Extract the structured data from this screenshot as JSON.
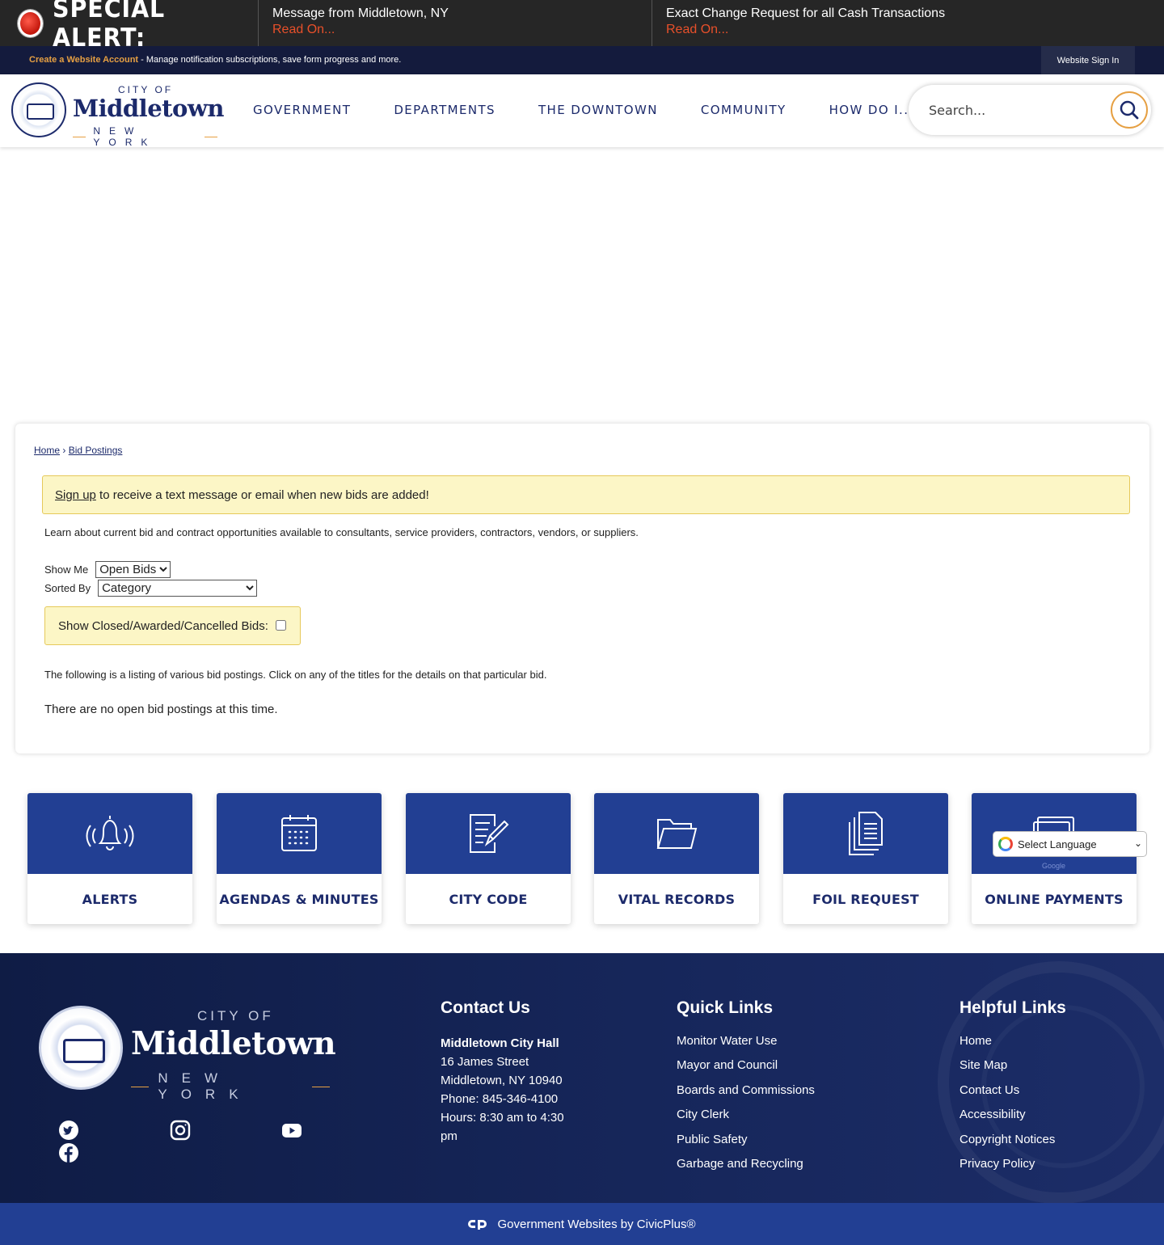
{
  "alert": {
    "title": "SPECIAL ALERT:",
    "messages": [
      {
        "title": "Message from Middletown, NY",
        "read_more": "Read On..."
      },
      {
        "title": "Exact Change Request for all Cash Transactions",
        "read_more": "Read On..."
      }
    ]
  },
  "account_bar": {
    "create_link": "Create a Website Account",
    "description": " - Manage notification subscriptions, save form progress and more.",
    "sign_in": "Website Sign In"
  },
  "header": {
    "logo": {
      "city_of": "CITY OF",
      "name": "Middletown",
      "state": "NEW YORK"
    },
    "nav": [
      "GOVERNMENT",
      "DEPARTMENTS",
      "THE DOWNTOWN",
      "COMMUNITY",
      "HOW DO I..."
    ],
    "search_placeholder": "Search..."
  },
  "main": {
    "breadcrumb": {
      "home": "Home",
      "separator": "›",
      "current": "Bid Postings"
    },
    "signup_link": "Sign up",
    "signup_text": " to receive a text message or email when new bids are added!",
    "intro": "Learn about current bid and contract opportunities available to consultants, service providers, contractors, vendors, or suppliers.",
    "show_me": {
      "label": "Show Me",
      "selected": "Open Bids"
    },
    "sorted_by": {
      "label": "Sorted By",
      "selected": "Category"
    },
    "show_closed_label": "Show Closed/Awarded/Cancelled Bids:",
    "show_closed_checked": false,
    "listing_note": "The following is a listing of various bid postings. Click on any of the titles for the details on that particular bid.",
    "empty_message": "There are no open bid postings at this time."
  },
  "quick_links": [
    {
      "label": "ALERTS",
      "icon": "bell-icon"
    },
    {
      "label": "AGENDAS & MINUTES",
      "icon": "calendar-icon"
    },
    {
      "label": "CITY CODE",
      "icon": "document-edit-icon"
    },
    {
      "label": "VITAL RECORDS",
      "icon": "folder-icon"
    },
    {
      "label": "FOIL REQUEST",
      "icon": "documents-icon"
    },
    {
      "label": "ONLINE PAYMENTS",
      "icon": "credit-card-icon"
    }
  ],
  "translate": {
    "label": "Select Language",
    "powered_by": "Google"
  },
  "footer": {
    "logo": {
      "city_of": "CITY OF",
      "name": "Middletown",
      "state": "NEW YORK"
    },
    "contact": {
      "heading": "Contact Us",
      "org": "Middletown City Hall",
      "street": "16 James Street",
      "city": "Middletown, NY 10940",
      "phone": "Phone: 845-346-4100",
      "hours": "Hours: 8:30 am to 4:30 pm"
    },
    "quick_links": {
      "heading": "Quick Links",
      "items": [
        "Monitor Water Use",
        "Mayor and Council",
        "Boards and Commissions",
        "City Clerk",
        "Public Safety",
        "Garbage and Recycling"
      ]
    },
    "helpful_links": {
      "heading": "Helpful Links",
      "items": [
        "Home",
        "Site Map",
        "Contact Us",
        "Accessibility",
        "Copyright Notices",
        "Privacy Policy"
      ]
    },
    "civicplus": "Government Websites by CivicPlus®"
  },
  "colors": {
    "navy": "#1c2a6b",
    "tile_blue": "#223f93",
    "accent_orange": "#e6a043",
    "alert_red": "#e8502a",
    "notice_yellow": "#fcf6c6"
  }
}
